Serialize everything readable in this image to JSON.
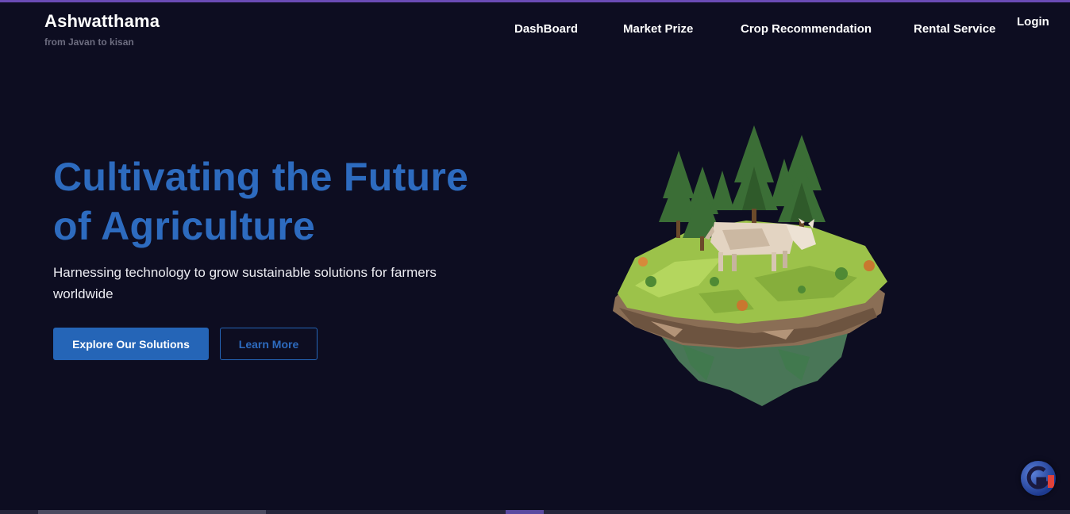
{
  "brand": {
    "title": "Ashwatthama",
    "tagline": "from Javan to kisan"
  },
  "nav": {
    "items": [
      {
        "label": "DashBoard"
      },
      {
        "label": "Market Prize"
      },
      {
        "label": "Crop Recommendation"
      },
      {
        "label": "Rental Service"
      }
    ],
    "login_label": "Login"
  },
  "hero": {
    "title": "Cultivating the Future of Agriculture",
    "subtitle": "Harnessing technology to grow sustainable solutions for farmers worldwide",
    "primary_button": "Explore Our Solutions",
    "secondary_button": "Learn More",
    "illustration_icon": "floating-island-cow-icon"
  },
  "floating_badge": {
    "icon": "assistant-logo-icon"
  },
  "colors": {
    "background": "#0d0d21",
    "accent": "#2565b7",
    "heading": "#2d6bbf",
    "top_stripe": "#6a4bb5"
  }
}
